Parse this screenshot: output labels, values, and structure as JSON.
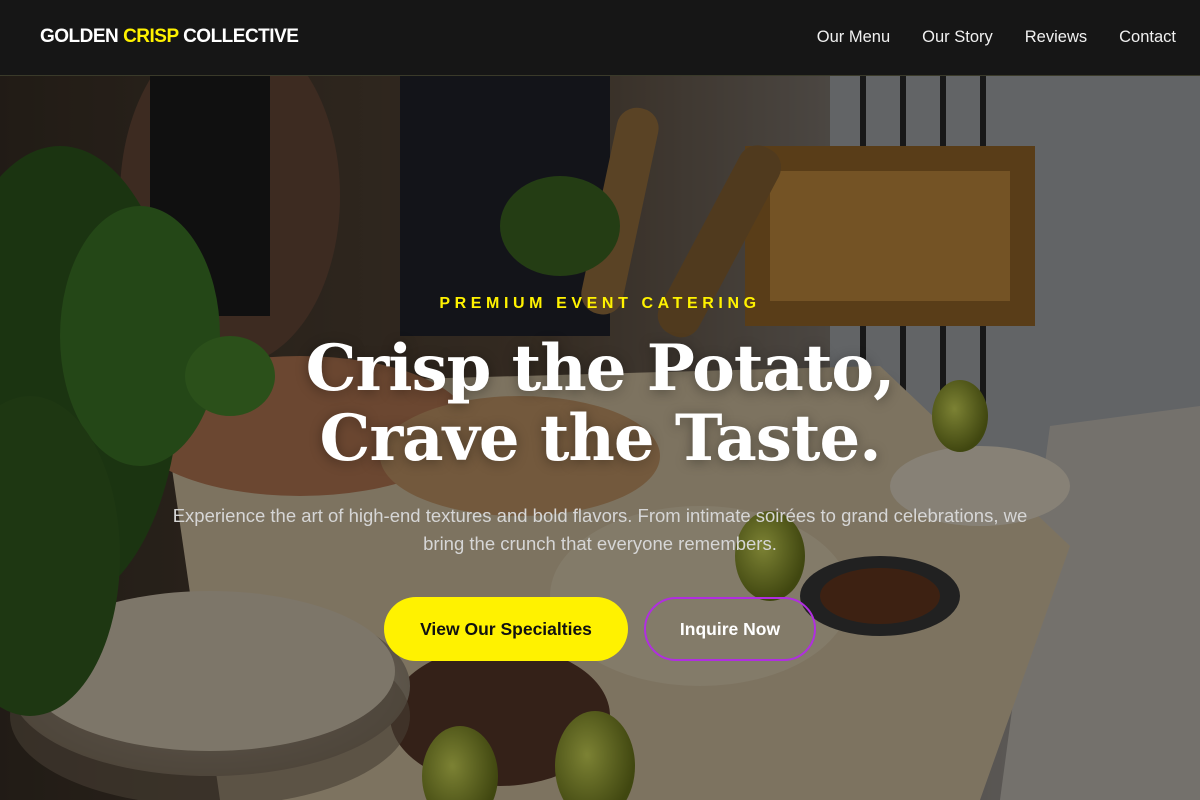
{
  "header": {
    "logo": {
      "part1": "GOLDEN ",
      "part2": "CRISP",
      "part3": " COLLECTIVE"
    },
    "nav": [
      {
        "label": "Our Menu"
      },
      {
        "label": "Our Story"
      },
      {
        "label": "Reviews"
      },
      {
        "label": "Contact"
      }
    ]
  },
  "hero": {
    "eyebrow": "PREMIUM EVENT CATERING",
    "headline_line1": "Crisp the Potato,",
    "headline_line2": "Crave the Taste.",
    "subtext": "Experience the art of high-end textures and bold flavors. From intimate soirées to grand celebrations, we bring the crunch that everyone remembers.",
    "primary_button": "View Our Specialties",
    "secondary_button": "Inquire Now"
  },
  "colors": {
    "background": "#161616",
    "accent_yellow": "#fff200",
    "accent_purple": "#b02ee0",
    "text_primary": "#ffffff"
  }
}
